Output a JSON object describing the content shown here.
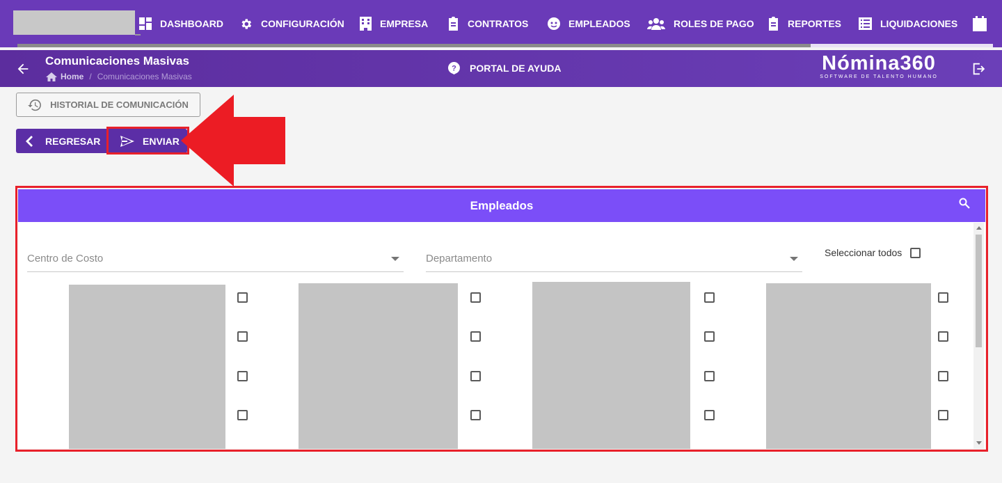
{
  "nav": {
    "items": [
      {
        "label": "DASHBOARD",
        "icon": "dashboard-icon"
      },
      {
        "label": "CONFIGURACIÓN",
        "icon": "gear-icon"
      },
      {
        "label": "EMPRESA",
        "icon": "building-icon"
      },
      {
        "label": "CONTRATOS",
        "icon": "clipboard-icon"
      },
      {
        "label": "EMPLEADOS",
        "icon": "face-icon"
      },
      {
        "label": "ROLES DE PAGO",
        "icon": "group-icon"
      },
      {
        "label": "REPORTES",
        "icon": "clipboard-icon"
      },
      {
        "label": "LIQUIDACIONES",
        "icon": "list-icon"
      }
    ],
    "extra_icon": "calendar-icon"
  },
  "header": {
    "title": "Comunicaciones Masivas",
    "breadcrumb": {
      "home": "Home",
      "separator": "/",
      "current": "Comunicaciones Masivas"
    },
    "help_label": "PORTAL DE AYUDA",
    "brand_name": "Nómina360",
    "brand_tagline": "SOFTWARE DE TALENTO HUMANO"
  },
  "actions": {
    "history_label": "HISTORIAL DE COMUNICACIÓN",
    "back_label": "REGRESAR",
    "send_label": "ENVIAR"
  },
  "panel": {
    "title": "Empleados",
    "cost_center_placeholder": "Centro de Costo",
    "department_placeholder": "Departamento",
    "select_all_label": "Seleccionar todos"
  },
  "colors": {
    "primary": "#6a3ab8",
    "panel_header": "#7b4ef8",
    "highlight": "#e8202a"
  }
}
